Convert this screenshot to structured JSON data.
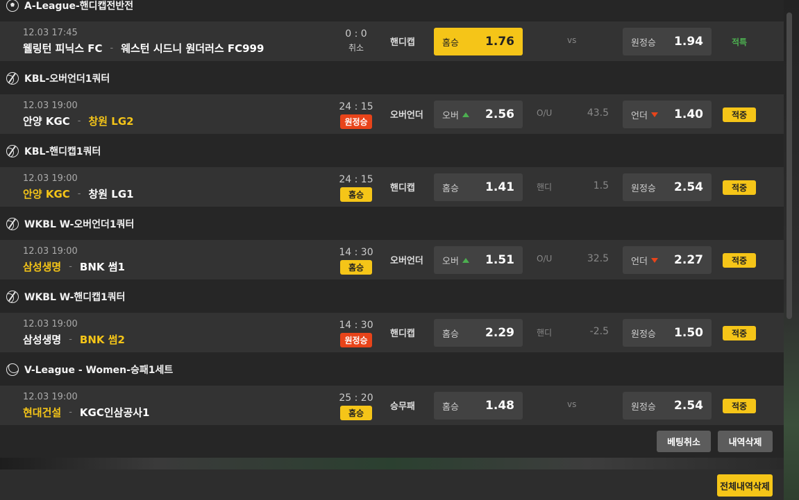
{
  "sections": [
    {
      "header": "A-League-핸디캡전반전",
      "icon": "soccer-ball-icon",
      "match": {
        "time": "12.03 17:45",
        "home": "웰링턴 피닉스 FC",
        "away": "웨스턴 시드니 원더러스 FC999",
        "home_highlight": false,
        "away_highlight": false,
        "score": "0 : 0",
        "status": "취소",
        "market": "핸디캡",
        "home_label": "홈승",
        "home_odd": "1.76",
        "mid_label": "vs",
        "mid_value": "",
        "away_label": "원정승",
        "away_odd": "1.94",
        "result": "적특"
      }
    },
    {
      "header": "KBL-오버언더1쿼터",
      "icon": "basketball-icon",
      "match": {
        "time": "12.03 19:00",
        "home": "안양 KGC",
        "away": "창원 LG2",
        "score": "24 : 15",
        "status": "원정승",
        "market": "오버언더",
        "home_label": "오버",
        "home_odd": "2.56",
        "mid_label": "O/U",
        "mid_value": "43.5",
        "away_label": "언더",
        "away_odd": "1.40",
        "result": "적중"
      }
    },
    {
      "header": "KBL-핸디캡1쿼터",
      "icon": "basketball-icon",
      "match": {
        "time": "12.03 19:00",
        "home": "안양 KGC",
        "away": "창원 LG1",
        "score": "24 : 15",
        "status": "홈승",
        "market": "핸디캡",
        "home_label": "홈승",
        "home_odd": "1.41",
        "mid_label": "핸디",
        "mid_value": "1.5",
        "away_label": "원정승",
        "away_odd": "2.54",
        "result": "적중"
      }
    },
    {
      "header": "WKBL W-오버언더1쿼터",
      "icon": "basketball-icon",
      "match": {
        "time": "12.03 19:00",
        "home": "삼성생명",
        "away": "BNK 썸1",
        "score": "14 : 30",
        "status": "홈승",
        "market": "오버언더",
        "home_label": "오버",
        "home_odd": "1.51",
        "mid_label": "O/U",
        "mid_value": "32.5",
        "away_label": "언더",
        "away_odd": "2.27",
        "result": "적중"
      }
    },
    {
      "header": "WKBL W-핸디캡1쿼터",
      "icon": "basketball-icon",
      "match": {
        "time": "12.03 19:00",
        "home": "삼성생명",
        "away": "BNK 썸2",
        "score": "14 : 30",
        "status": "원정승",
        "market": "핸디캡",
        "home_label": "홈승",
        "home_odd": "2.29",
        "mid_label": "핸디",
        "mid_value": "-2.5",
        "away_label": "원정승",
        "away_odd": "1.50",
        "result": "적중"
      }
    },
    {
      "header": "V-League - Women-승패1세트",
      "icon": "volleyball-icon",
      "match": {
        "time": "12.03 19:00",
        "home": "현대건설",
        "away": "KGC인삼공사1",
        "score": "25 : 20",
        "status": "홈승",
        "market": "승무패",
        "home_label": "홈승",
        "home_odd": "1.48",
        "mid_label": "vs",
        "mid_value": "",
        "away_label": "원정승",
        "away_odd": "2.54",
        "result": "적중"
      }
    }
  ],
  "separator": "-",
  "buttons": {
    "cancel_bet": "베팅취소",
    "delete_history": "내역삭제",
    "delete_all_history": "전체내역삭제"
  },
  "colors": {
    "accent": "#f5c518",
    "status_red": "#e8441a",
    "win_green": "#4caf50",
    "panel": "#262626",
    "row": "#333333"
  }
}
